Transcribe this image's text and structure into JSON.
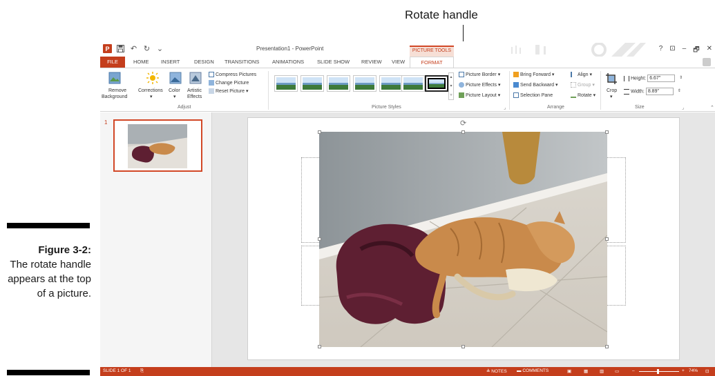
{
  "annotation": {
    "callout": "Rotate handle",
    "caption_title": "Figure 3-2:",
    "caption_body": "The rotate handle appears at the top of a picture."
  },
  "window": {
    "title": "Presentation1 - PowerPoint",
    "context_tab_group": "PICTURE TOOLS",
    "controls": {
      "help": "?",
      "restore_ribbon": "⊡",
      "minimize": "–",
      "maximize": "🗗",
      "close": "✕"
    }
  },
  "tabs": [
    {
      "label": "FILE"
    },
    {
      "label": "HOME"
    },
    {
      "label": "INSERT"
    },
    {
      "label": "DESIGN"
    },
    {
      "label": "TRANSITIONS"
    },
    {
      "label": "ANIMATIONS"
    },
    {
      "label": "SLIDE SHOW"
    },
    {
      "label": "REVIEW"
    },
    {
      "label": "VIEW"
    },
    {
      "label": "FORMAT"
    }
  ],
  "ribbon": {
    "adjust": {
      "label": "Adjust",
      "remove_background_l1": "Remove",
      "remove_background_l2": "Background",
      "corrections": "Corrections",
      "color": "Color",
      "artistic_l1": "Artistic",
      "artistic_l2": "Effects",
      "compress": "Compress Pictures",
      "change": "Change Picture",
      "reset": "Reset Picture"
    },
    "styles": {
      "label": "Picture Styles"
    },
    "picture_format": {
      "border": "Picture Border",
      "effects": "Picture Effects",
      "layout": "Picture Layout"
    },
    "arrange": {
      "label": "Arrange",
      "bring_forward": "Bring Forward",
      "send_backward": "Send Backward",
      "selection_pane": "Selection Pane",
      "align": "Align",
      "group": "Group",
      "rotate": "Rotate"
    },
    "size": {
      "label": "Size",
      "crop": "Crop",
      "height_label": "Height:",
      "height_value": "6.67\"",
      "width_label": "Width:",
      "width_value": "8.89\""
    }
  },
  "thumbnails": [
    {
      "number": "1"
    }
  ],
  "statusbar": {
    "slide": "SLIDE 1 OF 1",
    "notes": "NOTES",
    "comments": "COMMENTS",
    "zoom": "74%"
  },
  "colors": {
    "accent": "#c43e1c",
    "accent_light": "#f6dfd6",
    "towel": "#5e1f32",
    "cat": "#c98a4b"
  }
}
